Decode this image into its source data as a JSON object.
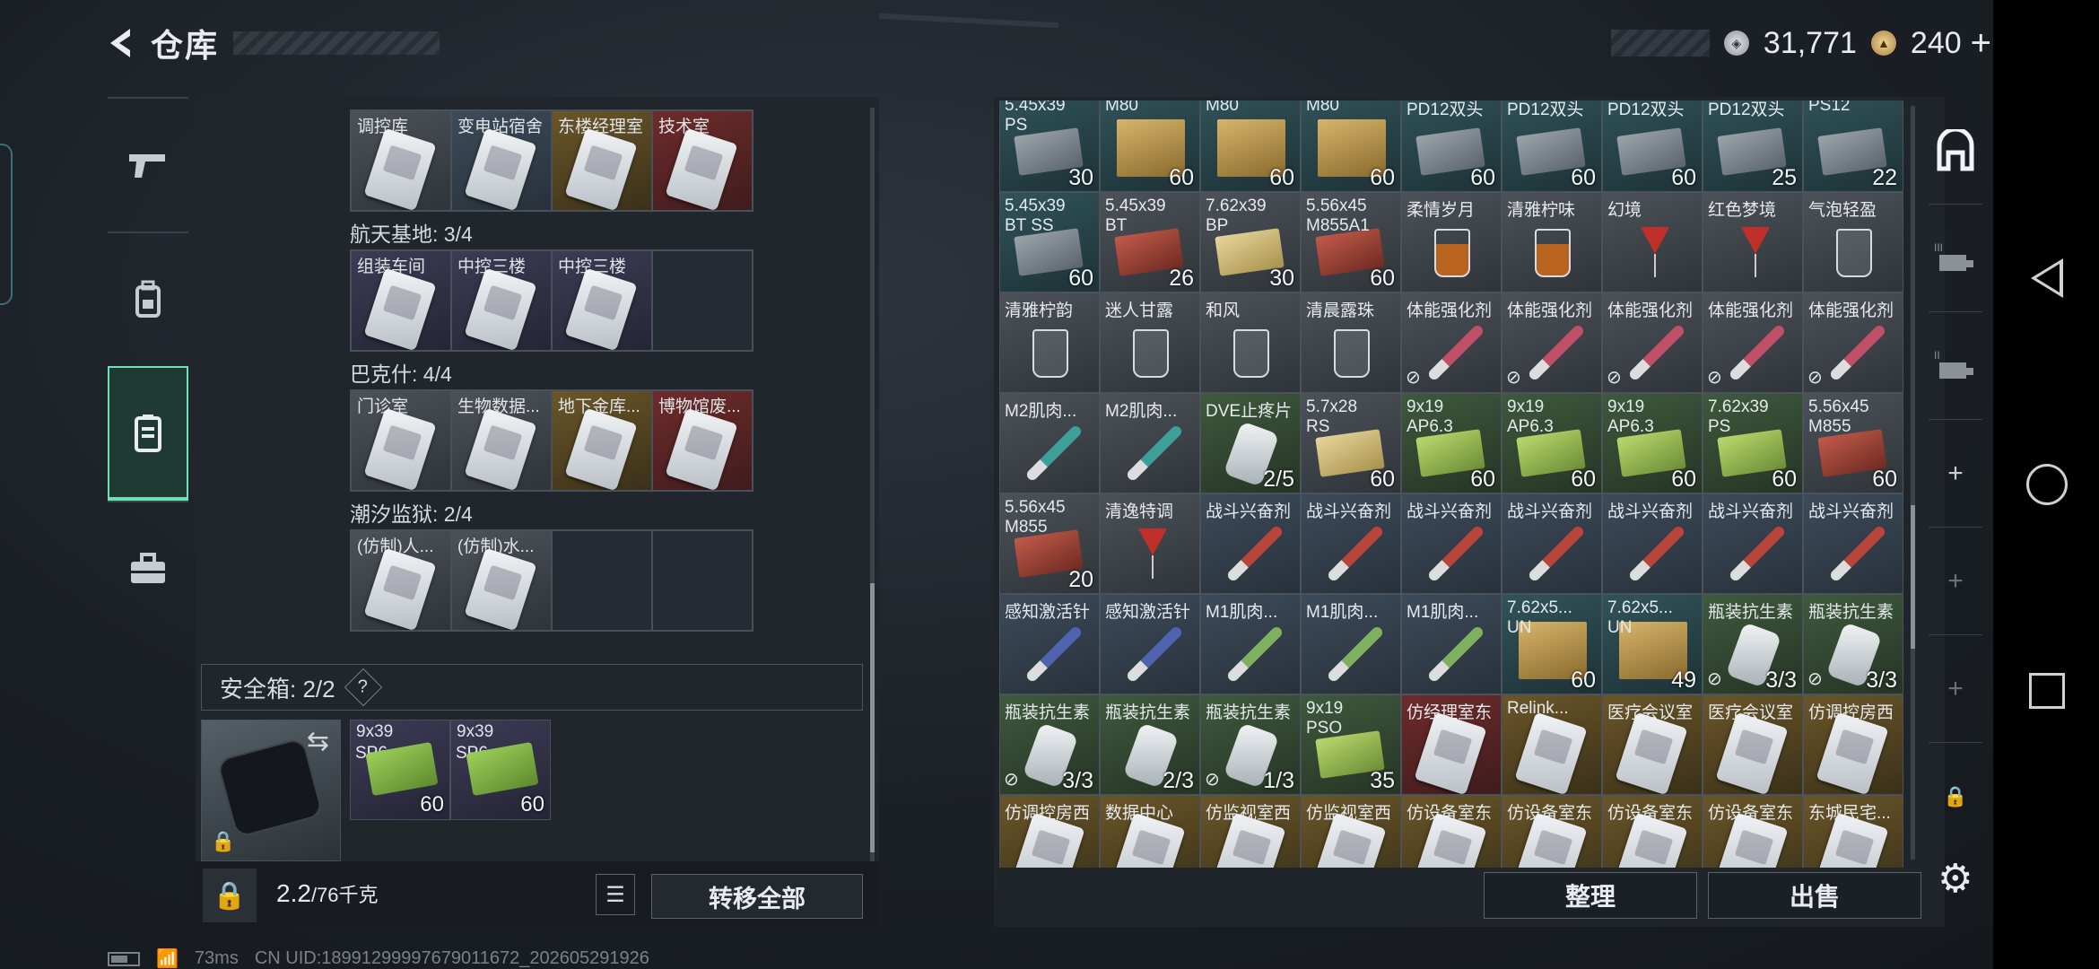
{
  "header": {
    "title": "仓库",
    "back_icon": "‹"
  },
  "currency": {
    "silver": "31,771",
    "gold": "240",
    "plus": "+"
  },
  "side_tabs": [
    {
      "name": "weapons",
      "icon": "🔫"
    },
    {
      "name": "gear",
      "icon": "🎒"
    },
    {
      "name": "keycards",
      "icon": "🪪"
    },
    {
      "name": "case",
      "icon": "💼"
    }
  ],
  "left": {
    "row0": [
      {
        "label": "调控库",
        "color": "white"
      },
      {
        "label": "变电站宿舍",
        "color": "blue"
      },
      {
        "label": "东楼经理室",
        "color": "gold"
      },
      {
        "label": "技术室",
        "color": "red"
      }
    ],
    "sections": [
      {
        "title": "航天基地: 3/4",
        "slots": [
          {
            "label": "组装车间",
            "color": "purple"
          },
          {
            "label": "中控三楼",
            "color": "purple"
          },
          {
            "label": "中控三楼",
            "color": "purple"
          },
          {
            "label": "",
            "color": "empty"
          }
        ]
      },
      {
        "title": "巴克什: 4/4",
        "slots": [
          {
            "label": "门诊室",
            "color": "white"
          },
          {
            "label": "生物数据...",
            "color": "white"
          },
          {
            "label": "地下金库...",
            "color": "gold"
          },
          {
            "label": "博物馆废...",
            "color": "red"
          }
        ]
      },
      {
        "title": "潮汐监狱: 2/4",
        "slots": [
          {
            "label": "(仿制)人...",
            "color": "white"
          },
          {
            "label": "(仿制)水...",
            "color": "white"
          },
          {
            "label": "",
            "color": "empty"
          },
          {
            "label": "",
            "color": "empty"
          }
        ]
      }
    ],
    "safe_box": {
      "label": "安全箱: 2/2",
      "help": "?"
    },
    "ammo": [
      {
        "label1": "9x39",
        "label2": "SP6",
        "count": "60"
      },
      {
        "label1": "9x39",
        "label2": "SP6",
        "count": "60"
      }
    ],
    "weight": {
      "value": "2.2",
      "max": "/76千克"
    },
    "move_all": "转移全部"
  },
  "right": {
    "rows": [
      [
        {
          "l": "5.45x39",
          "l2": "PS",
          "t": "ammo-s",
          "c": "30"
        },
        {
          "l": "M80",
          "t": "crate",
          "c": "60"
        },
        {
          "l": "M80",
          "t": "crate",
          "c": "60"
        },
        {
          "l": "M80",
          "t": "crate",
          "c": "60"
        },
        {
          "l": "PD12双头",
          "t": "ammo-s",
          "c": "60"
        },
        {
          "l": "PD12双头",
          "t": "ammo-s",
          "c": "60"
        },
        {
          "l": "PD12双头",
          "t": "ammo-s",
          "c": "60"
        },
        {
          "l": "PD12双头",
          "t": "ammo-s",
          "c": "25"
        },
        {
          "l": "PS12",
          "t": "ammo-s",
          "c": "22"
        }
      ],
      [
        {
          "l": "5.45x39",
          "l2": "BT SS",
          "t": "ammo-s",
          "c": "60"
        },
        {
          "l": "5.45x39",
          "l2": "BT",
          "t": "ammo-r",
          "c": "26"
        },
        {
          "l": "7.62x39",
          "l2": "BP",
          "t": "ammo-y",
          "c": "30"
        },
        {
          "l": "5.56x45",
          "l2": "M855A1",
          "t": "ammo-r",
          "c": "60"
        },
        {
          "l": "柔情岁月",
          "t": "glass-amber",
          "c": ""
        },
        {
          "l": "清雅柠味",
          "t": "glass-amber",
          "c": ""
        },
        {
          "l": "幻境",
          "t": "cocktail",
          "c": ""
        },
        {
          "l": "红色梦境",
          "t": "cocktail",
          "c": ""
        },
        {
          "l": "气泡轻盈",
          "t": "glass",
          "c": ""
        }
      ],
      [
        {
          "l": "清雅柠韵",
          "t": "glass",
          "c": ""
        },
        {
          "l": "迷人甘露",
          "t": "glass",
          "c": ""
        },
        {
          "l": "和风",
          "t": "glass",
          "c": ""
        },
        {
          "l": "清晨露珠",
          "t": "glass",
          "c": ""
        },
        {
          "l": "体能强化剂",
          "t": "syringe",
          "c": "",
          "ns": true
        },
        {
          "l": "体能强化剂",
          "t": "syringe",
          "c": "",
          "ns": true
        },
        {
          "l": "体能强化剂",
          "t": "syringe",
          "c": "",
          "ns": true
        },
        {
          "l": "体能强化剂",
          "t": "syringe",
          "c": "",
          "ns": true
        },
        {
          "l": "体能强化剂",
          "t": "syringe",
          "c": "",
          "ns": true
        }
      ],
      [
        {
          "l": "M2肌肉...",
          "t": "syringe-teal",
          "c": ""
        },
        {
          "l": "M2肌肉...",
          "t": "syringe-teal",
          "c": ""
        },
        {
          "l": "DVE止疼片",
          "t": "bottle",
          "c": "2/5"
        },
        {
          "l": "5.7x28",
          "l2": "RS",
          "t": "ammo-y",
          "c": "60"
        },
        {
          "l": "9x19",
          "l2": "AP6.3",
          "t": "ammo-g",
          "c": "60"
        },
        {
          "l": "9x19",
          "l2": "AP6.3",
          "t": "ammo-g",
          "c": "60"
        },
        {
          "l": "9x19",
          "l2": "AP6.3",
          "t": "ammo-g",
          "c": "60"
        },
        {
          "l": "7.62x39",
          "l2": "PS",
          "t": "ammo-g",
          "c": "60"
        },
        {
          "l": "5.56x45",
          "l2": "M855",
          "t": "ammo-r",
          "c": "60"
        }
      ],
      [
        {
          "l": "5.56x45",
          "l2": "M855",
          "t": "ammo-r",
          "c": "20"
        },
        {
          "l": "清逸特调",
          "t": "cocktail",
          "c": ""
        },
        {
          "l": "战斗兴奋剂",
          "t": "syringe-red",
          "c": ""
        },
        {
          "l": "战斗兴奋剂",
          "t": "syringe-red",
          "c": ""
        },
        {
          "l": "战斗兴奋剂",
          "t": "syringe-red",
          "c": ""
        },
        {
          "l": "战斗兴奋剂",
          "t": "syringe-red",
          "c": ""
        },
        {
          "l": "战斗兴奋剂",
          "t": "syringe-red",
          "c": ""
        },
        {
          "l": "战斗兴奋剂",
          "t": "syringe-red",
          "c": ""
        },
        {
          "l": "战斗兴奋剂",
          "t": "syringe-red",
          "c": ""
        }
      ],
      [
        {
          "l": "感知激活针",
          "t": "syringe-blue",
          "c": ""
        },
        {
          "l": "感知激活针",
          "t": "syringe-blue",
          "c": ""
        },
        {
          "l": "M1肌肉...",
          "t": "syringe-green",
          "c": ""
        },
        {
          "l": "M1肌肉...",
          "t": "syringe-green",
          "c": ""
        },
        {
          "l": "M1肌肉...",
          "t": "syringe-green",
          "c": ""
        },
        {
          "l": "7.62x5...",
          "l2": "UN",
          "t": "crate",
          "c": "60"
        },
        {
          "l": "7.62x5...",
          "l2": "UN",
          "t": "crate",
          "c": "49"
        },
        {
          "l": "瓶装抗生素",
          "t": "bottle",
          "c": "3/3",
          "ns": true
        },
        {
          "l": "瓶装抗生素",
          "t": "bottle",
          "c": "3/3",
          "ns": true
        }
      ],
      [
        {
          "l": "瓶装抗生素",
          "t": "bottle",
          "c": "3/3",
          "ns": true
        },
        {
          "l": "瓶装抗生素",
          "t": "bottle",
          "c": "2/3"
        },
        {
          "l": "瓶装抗生素",
          "t": "bottle",
          "c": "1/3",
          "ns": true
        },
        {
          "l": "9x19",
          "l2": "PSO",
          "t": "ammo-g",
          "c": "35"
        },
        {
          "l": "仿经理室东",
          "t": "card-gold",
          "c": ""
        },
        {
          "l": "Relink...",
          "t": "card",
          "c": ""
        },
        {
          "l": "医疗会议室",
          "t": "card",
          "c": ""
        },
        {
          "l": "医疗会议室",
          "t": "card",
          "c": ""
        },
        {
          "l": "仿调控房西",
          "t": "card",
          "c": ""
        }
      ],
      [
        {
          "l": "仿调控房西",
          "t": "card",
          "c": ""
        },
        {
          "l": "数据中心",
          "t": "card",
          "c": ""
        },
        {
          "l": "仿监视室西",
          "t": "card",
          "c": ""
        },
        {
          "l": "仿监视室西",
          "t": "card",
          "c": ""
        },
        {
          "l": "仿设备室东",
          "t": "card",
          "c": ""
        },
        {
          "l": "仿设备室东",
          "t": "card",
          "c": ""
        },
        {
          "l": "仿设备室东",
          "t": "card",
          "c": ""
        },
        {
          "l": "仿设备室东",
          "t": "card",
          "c": ""
        },
        {
          "l": "东城民宅...",
          "t": "card",
          "c": ""
        }
      ]
    ],
    "sort": "整理",
    "sell": "出售"
  },
  "status": {
    "ping": "73ms",
    "uid": "CN UID:18991299997679011672_202605291926"
  }
}
